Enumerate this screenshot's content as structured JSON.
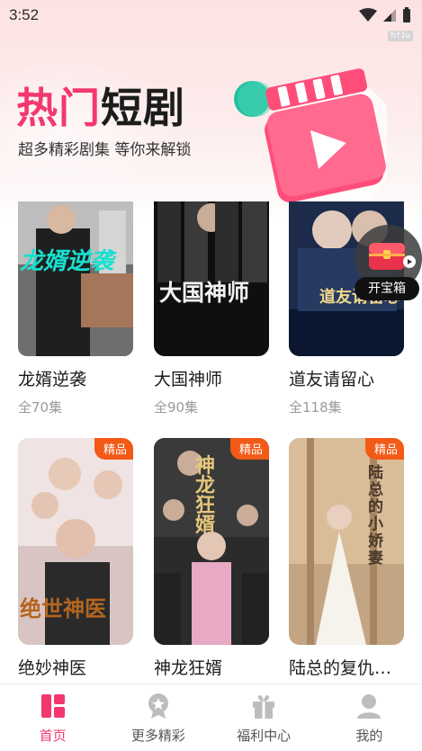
{
  "status_bar": {
    "time": "3:52",
    "badge": "hf1u"
  },
  "hero": {
    "title_pink": "热门",
    "title_black": "短剧",
    "subtitle": "超多精彩剧集 等你来解锁"
  },
  "float_widget": {
    "label": "开宝箱",
    "icon": "treasure-chest-icon"
  },
  "row1": [
    {
      "title": "龙婿逆袭",
      "count": "全70集",
      "poster_text": "龙婿逆袭"
    },
    {
      "title": "大国神师",
      "count": "全90集",
      "poster_text": "大国神师"
    },
    {
      "title": "道友请留心",
      "count": "全118集",
      "poster_text": "道友请留心"
    }
  ],
  "row2": [
    {
      "title": "绝妙神医",
      "badge": "精品",
      "poster_text": "绝世神医"
    },
    {
      "title": "神龙狂婿",
      "badge": "精品",
      "poster_text": "神龙狂婿"
    },
    {
      "title": "陆总的复仇…",
      "badge": "精品",
      "poster_text": "陆总的小娇妻"
    }
  ],
  "tabbar": [
    {
      "label": "首页",
      "icon": "home-grid-icon",
      "active": true
    },
    {
      "label": "更多精彩",
      "icon": "star-badge-icon",
      "active": false
    },
    {
      "label": "福利中心",
      "icon": "gift-icon",
      "active": false
    },
    {
      "label": "我的",
      "icon": "user-icon",
      "active": false
    }
  ],
  "colors": {
    "accent": "#f2386e",
    "badge": "#f25a16"
  }
}
